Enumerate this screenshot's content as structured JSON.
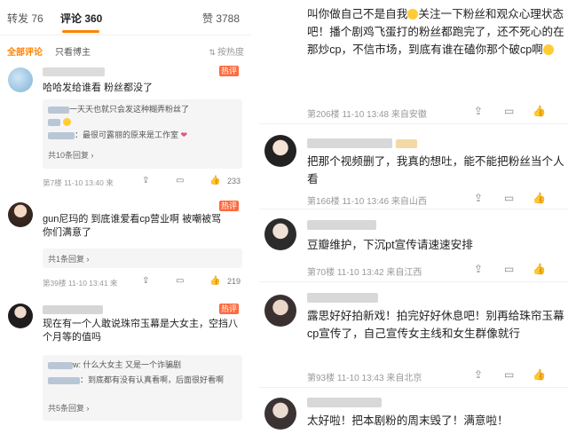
{
  "left": {
    "tabs": [
      {
        "label": "转发 76"
      },
      {
        "label": "评论 360"
      },
      {
        "label": "赞 3788"
      }
    ],
    "filters": {
      "all": "全部评论",
      "blogger": "只看博主",
      "sort": "按热度"
    },
    "comments": [
      {
        "text": "哈哈发给谁看 粉丝都没了",
        "badge": "热评",
        "replies": [
          "一天天也就只会发这种糊弄粉丝了",
          "：最很可露丽的原来是工作室"
        ],
        "more": "共10条回复 ›",
        "meta": "第7楼 11-10 13:40 来",
        "likes": "233"
      },
      {
        "text": "gun尼玛的 到底谁爱看cp营业啊 被嘲被骂你们满意了",
        "badge": "热评",
        "more": "共1条回复 ›",
        "meta": "第39楼 11-10 13:41 来",
        "likes": "219"
      },
      {
        "text": "现在有一个人敢说珠帘玉幕是大女主，空挡八个月等的值吗",
        "badge": "热评",
        "replies": [
          "w: 什么大女主 又是一个诈骗剧",
          "：到底都有没有认真看啊，后面很好看啊"
        ],
        "more": "共5条回复 ›"
      }
    ],
    "icons": {
      "share": "share-icon",
      "comment": "comment-icon",
      "like": "thumbs-up-icon"
    }
  },
  "right": {
    "comments": [
      {
        "text_a": "叫你做自己不是自我",
        "text_b": "关注一下粉丝和观众心理状态吧！播个剧鸡飞蛋打的粉丝都跑完了，还不死心的在那炒cp，不信市场，到底有谁在磕你那个破cp啊",
        "meta": "第206楼 11-10 13:48 来自安徽"
      },
      {
        "text": "把那个视频删了，我真的想吐，能不能把粉丝当个人看",
        "meta": "第166楼 11-10 13:46 来自山西"
      },
      {
        "text": "豆瓣维护，下沉pt宣传请速速安排",
        "meta": "第70楼 11-10 13:42 来自江西"
      },
      {
        "text": "露思好好拍新戏！拍完好好休息吧！别再给珠帘玉幕cp宣传了，自己宣传女主线和女生群像就行",
        "meta": "第93楼 11-10 13:43 来自北京"
      },
      {
        "text": "太好啦！把本剧粉的周末毁了！满意啦！"
      }
    ]
  },
  "colors": {
    "accent": "#ff8200",
    "hot": "#ff6a3c",
    "muted": "#999999"
  }
}
